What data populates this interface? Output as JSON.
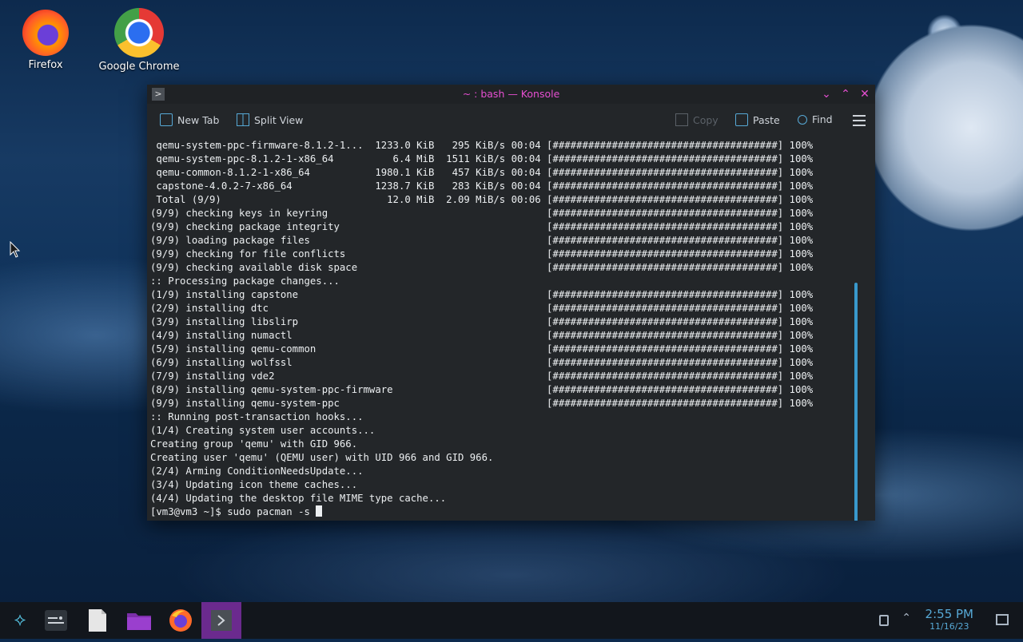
{
  "desktop": {
    "icons": [
      {
        "label": "Firefox"
      },
      {
        "label": "Google Chrome"
      }
    ]
  },
  "window": {
    "title": "~ : bash — Konsole",
    "toolbar": {
      "new_tab": "New Tab",
      "split_view": "Split View",
      "copy": "Copy",
      "paste": "Paste",
      "find": "Find"
    },
    "terminal_lines": [
      " qemu-system-ppc-firmware-8.1.2-1...  1233.0 KiB   295 KiB/s 00:04 [######################################] 100%",
      " qemu-system-ppc-8.1.2-1-x86_64          6.4 MiB  1511 KiB/s 00:04 [######################################] 100%",
      " qemu-common-8.1.2-1-x86_64           1980.1 KiB   457 KiB/s 00:04 [######################################] 100%",
      " capstone-4.0.2-7-x86_64              1238.7 KiB   283 KiB/s 00:04 [######################################] 100%",
      " Total (9/9)                            12.0 MiB  2.09 MiB/s 00:06 [######################################] 100%",
      "(9/9) checking keys in keyring                                     [######################################] 100%",
      "(9/9) checking package integrity                                   [######################################] 100%",
      "(9/9) loading package files                                        [######################################] 100%",
      "(9/9) checking for file conflicts                                  [######################################] 100%",
      "(9/9) checking available disk space                                [######################################] 100%",
      ":: Processing package changes...",
      "(1/9) installing capstone                                          [######################################] 100%",
      "(2/9) installing dtc                                               [######################################] 100%",
      "(3/9) installing libslirp                                          [######################################] 100%",
      "(4/9) installing numactl                                           [######################################] 100%",
      "(5/9) installing qemu-common                                       [######################################] 100%",
      "(6/9) installing wolfssl                                           [######################################] 100%",
      "(7/9) installing vde2                                              [######################################] 100%",
      "(8/9) installing qemu-system-ppc-firmware                          [######################################] 100%",
      "(9/9) installing qemu-system-ppc                                   [######################################] 100%",
      ":: Running post-transaction hooks...",
      "(1/4) Creating system user accounts...",
      "Creating group 'qemu' with GID 966.",
      "Creating user 'qemu' (QEMU user) with UID 966 and GID 966.",
      "(2/4) Arming ConditionNeedsUpdate...",
      "(3/4) Updating icon theme caches...",
      "(4/4) Updating the desktop file MIME type cache..."
    ],
    "prompt": "[vm3@vm3 ~]$ sudo pacman -s "
  },
  "taskbar": {
    "clock_time": "2:55 PM",
    "clock_date": "11/16/23"
  },
  "colors": {
    "accent": "#e64fd1",
    "active_task": "#6b2a8e",
    "clock": "#57a9d6"
  }
}
